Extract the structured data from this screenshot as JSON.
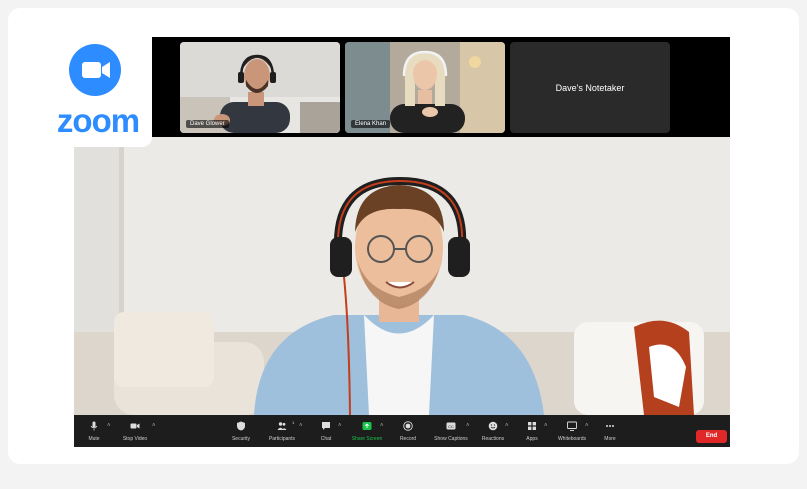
{
  "logo": {
    "brand": "zoom",
    "icon": "video-camera-icon",
    "brand_color": "#2d8cff"
  },
  "participants": [
    {
      "name": "Dave Glower"
    },
    {
      "name": "Elena Khan"
    },
    {
      "name": "Dave's Notetaker"
    }
  ],
  "toolbar": {
    "left": [
      {
        "label": "Mute",
        "icon": "microphone-icon"
      },
      {
        "label": "Stop Video",
        "icon": "video-camera-icon"
      }
    ],
    "center": [
      {
        "label": "Security",
        "icon": "shield-icon"
      },
      {
        "label": "Participants",
        "icon": "people-icon",
        "count": "1"
      },
      {
        "label": "Chat",
        "icon": "chat-icon"
      },
      {
        "label": "Share Screen",
        "icon": "share-screen-icon",
        "color": "#19c34a"
      },
      {
        "label": "Record",
        "icon": "record-icon"
      },
      {
        "label": "Show Captions",
        "icon": "captions-icon"
      },
      {
        "label": "Reactions",
        "icon": "smiley-icon"
      },
      {
        "label": "Apps",
        "icon": "apps-icon"
      },
      {
        "label": "Whiteboards",
        "icon": "whiteboard-icon"
      },
      {
        "label": "More",
        "icon": "more-icon"
      }
    ],
    "end_label": "End",
    "end_color": "#e02828"
  }
}
